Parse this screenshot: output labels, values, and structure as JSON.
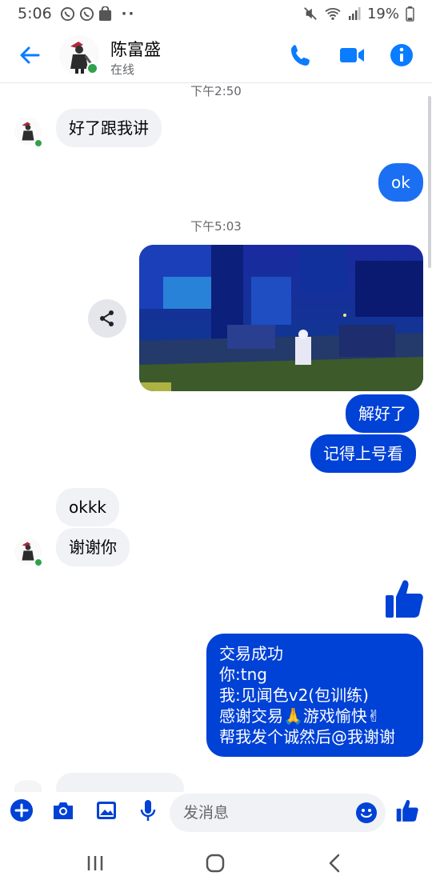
{
  "status_bar": {
    "time": "5:06",
    "notification_icons": [
      "whatsapp-icon",
      "whatsapp-icon",
      "shop-icon"
    ],
    "more_indicator": "··",
    "battery_percent": "19%"
  },
  "header": {
    "contact_name": "陈富盛",
    "contact_status": "在线",
    "accent_color": "#1877f2"
  },
  "messages": {
    "ts1": "下午2:50",
    "m1": "好了跟我讲",
    "m2": "ok",
    "ts2": "下午5:03",
    "m4": "解好了",
    "m5": "记得上号看",
    "m6": "okkk",
    "m7": "谢谢你",
    "m9_lines": [
      "交易成功",
      "你:tng",
      "我:见闻色v2(包训练)",
      "感谢交易🙏游戏愉快✌",
      "帮我发个诚然后@我谢谢"
    ]
  },
  "composer": {
    "placeholder": "发消息"
  },
  "colors": {
    "outgoing_bubble": "#0041d6",
    "incoming_bubble": "#f0f2f5",
    "online": "#31a24c"
  }
}
